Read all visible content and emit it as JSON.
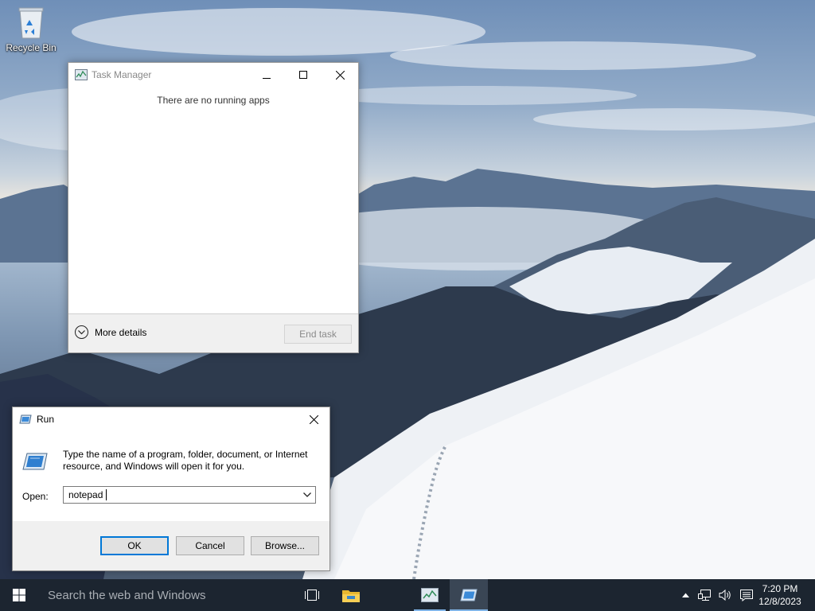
{
  "desktop": {
    "icons": [
      {
        "label": "Recycle Bin",
        "icon": "recycle-bin-icon"
      }
    ]
  },
  "task_manager": {
    "title": "Task Manager",
    "empty_message": "There are no running apps",
    "more_details_label": "More details",
    "end_task_label": "End task",
    "end_task_enabled": false
  },
  "run_dialog": {
    "title": "Run",
    "description": "Type the name of a program, folder, document, or Internet resource, and Windows will open it for you.",
    "open_label": "Open:",
    "open_value": "notepad",
    "ok_label": "OK",
    "cancel_label": "Cancel",
    "browse_label": "Browse..."
  },
  "taskbar": {
    "search_placeholder": "Search the web and Windows",
    "pinned": [
      {
        "name": "task-view-icon"
      },
      {
        "name": "file-explorer-icon"
      },
      {
        "name": "task-manager-icon",
        "running": true
      },
      {
        "name": "run-icon",
        "active": true
      }
    ],
    "tray": [
      "show-hidden-icons-icon",
      "network-icon",
      "volume-icon",
      "action-center-icon"
    ],
    "time": "7:20 PM",
    "date": "12/8/2023"
  },
  "colors": {
    "taskbar": "#1c2530",
    "accent": "#0078d7",
    "active_indicator": "#7fb3e6"
  }
}
